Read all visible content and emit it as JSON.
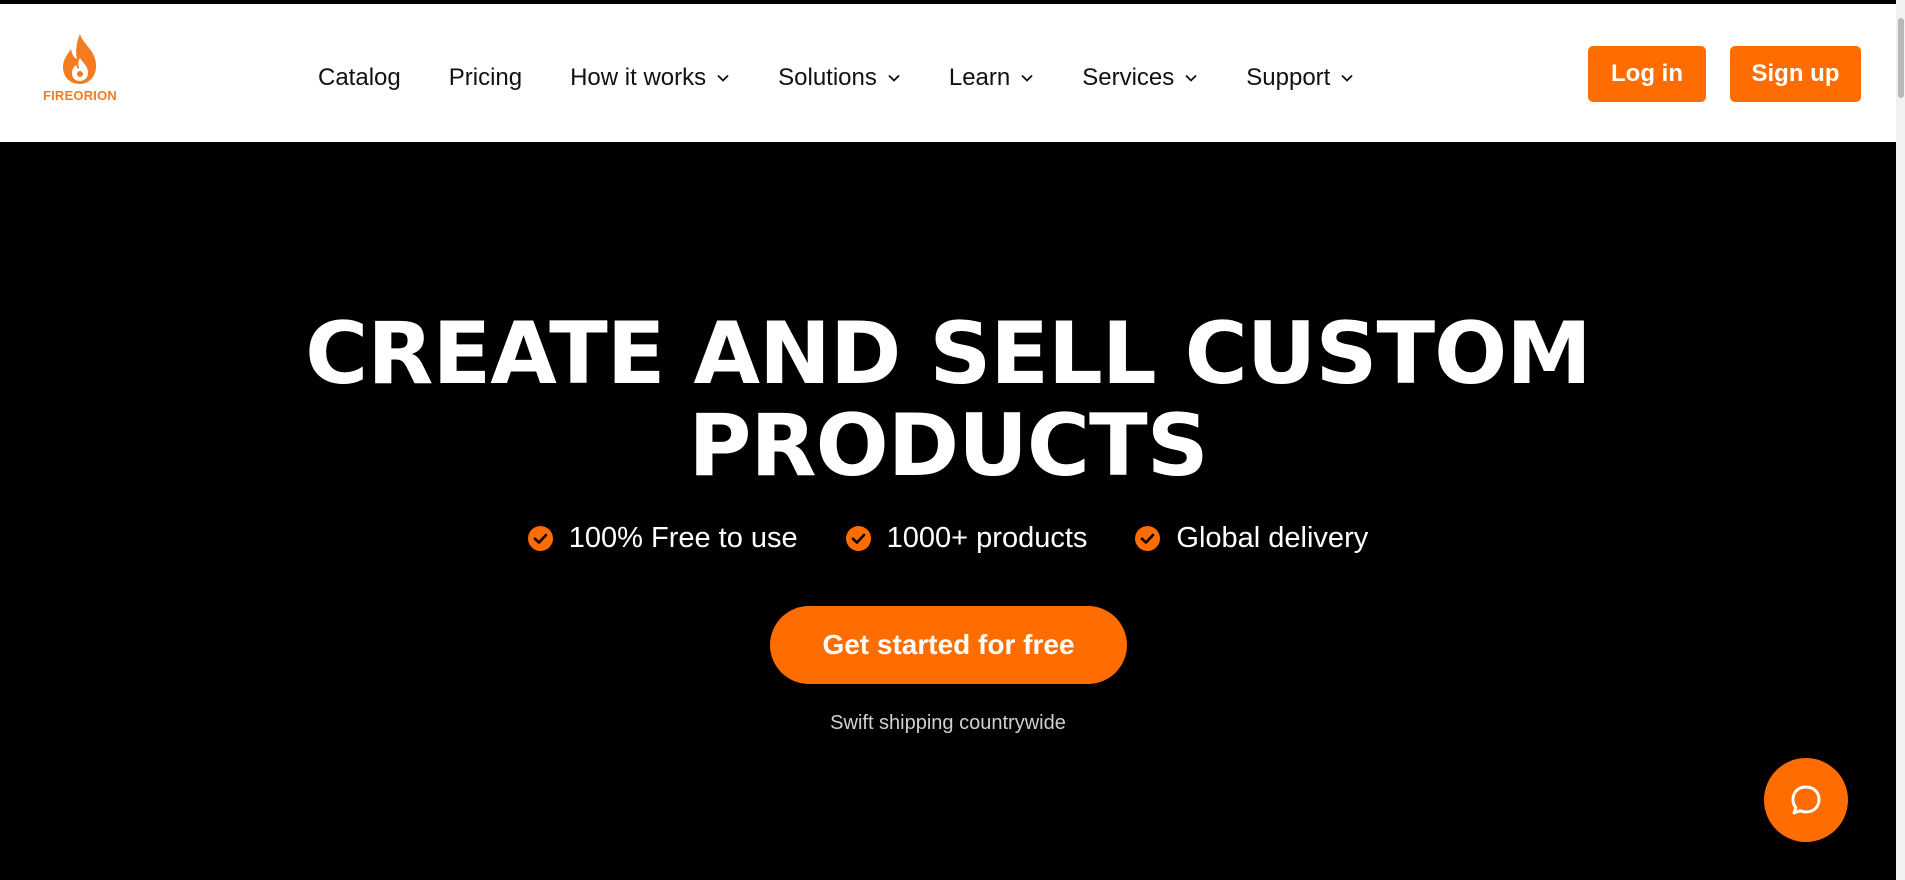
{
  "brand": {
    "name": "FIREORION",
    "color": "#f47b20",
    "logo_icon": "flame-icon"
  },
  "nav": {
    "items": [
      {
        "label": "Catalog",
        "dropdown": false
      },
      {
        "label": "Pricing",
        "dropdown": false
      },
      {
        "label": "How it works",
        "dropdown": true
      },
      {
        "label": "Solutions",
        "dropdown": true
      },
      {
        "label": "Learn",
        "dropdown": true
      },
      {
        "label": "Services",
        "dropdown": true
      },
      {
        "label": "Support",
        "dropdown": true
      }
    ],
    "login_label": "Log in",
    "signup_label": "Sign up"
  },
  "hero": {
    "title_line1": "CREATE AND SELL CUSTOM",
    "title_line2": "PRODUCTS",
    "features": [
      {
        "icon": "check-circle-icon",
        "label": "100% Free to use"
      },
      {
        "icon": "check-circle-icon",
        "label": "1000+ products"
      },
      {
        "icon": "check-circle-icon",
        "label": "Global delivery"
      }
    ],
    "cta_label": "Get started for free",
    "subnote": "Swift shipping countrywide"
  },
  "chat": {
    "icon": "chat-bubble-icon"
  },
  "colors": {
    "accent": "#ff6d00",
    "background": "#000000",
    "header_bg": "#ffffff"
  }
}
